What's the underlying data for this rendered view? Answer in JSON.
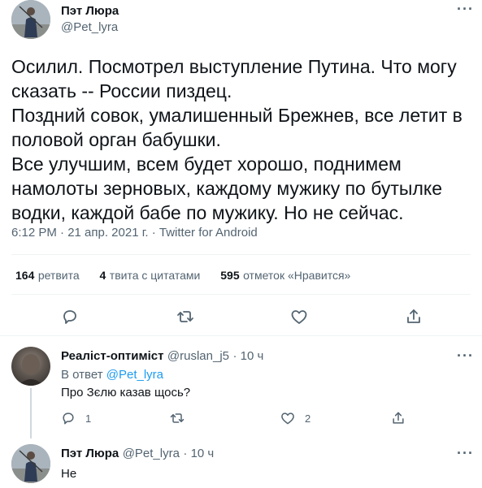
{
  "main_tweet": {
    "author_name": "Пэт Люра",
    "author_handle": "@Pet_lyra",
    "lines": [
      "Осилил. Посмотрел выступление Путина. Что могу",
      "сказать -- России пиздец.",
      "Поздний совок, умалишенный Брежнев, все летит в",
      "половой орган бабушки.",
      "Все улучшим, всем будет хорошо, поднимем",
      "намолоты зерновых, каждому мужику по бутылке",
      "водки, каждой бабе по мужику. Но не сейчас."
    ],
    "meta": "6:12 PM · 21 апр. 2021 г. · Twitter for Android",
    "stats": {
      "retweets_count": "164",
      "retweets_label": "ретвита",
      "quotes_count": "4",
      "quotes_label": "твита с цитатами",
      "likes_count": "595",
      "likes_label": "отметок «Нравится»"
    },
    "actions": [
      "reply-icon",
      "retweet-icon",
      "like-icon",
      "share-icon"
    ]
  },
  "replies": [
    {
      "author_name": "Реаліст-оптиміст",
      "author_handle": "@ruslan_j5",
      "time": "· 10 ч",
      "reply_to_label": "В ответ",
      "reply_to_handle": "@Pet_lyra",
      "text": "Про Зєлю казав щось?",
      "reply_count": "1",
      "retweet_count": "",
      "like_count": "2"
    },
    {
      "author_name": "Пэт Люра",
      "author_handle": "@Pet_lyra",
      "time": "· 10 ч",
      "text": "Не"
    }
  ]
}
